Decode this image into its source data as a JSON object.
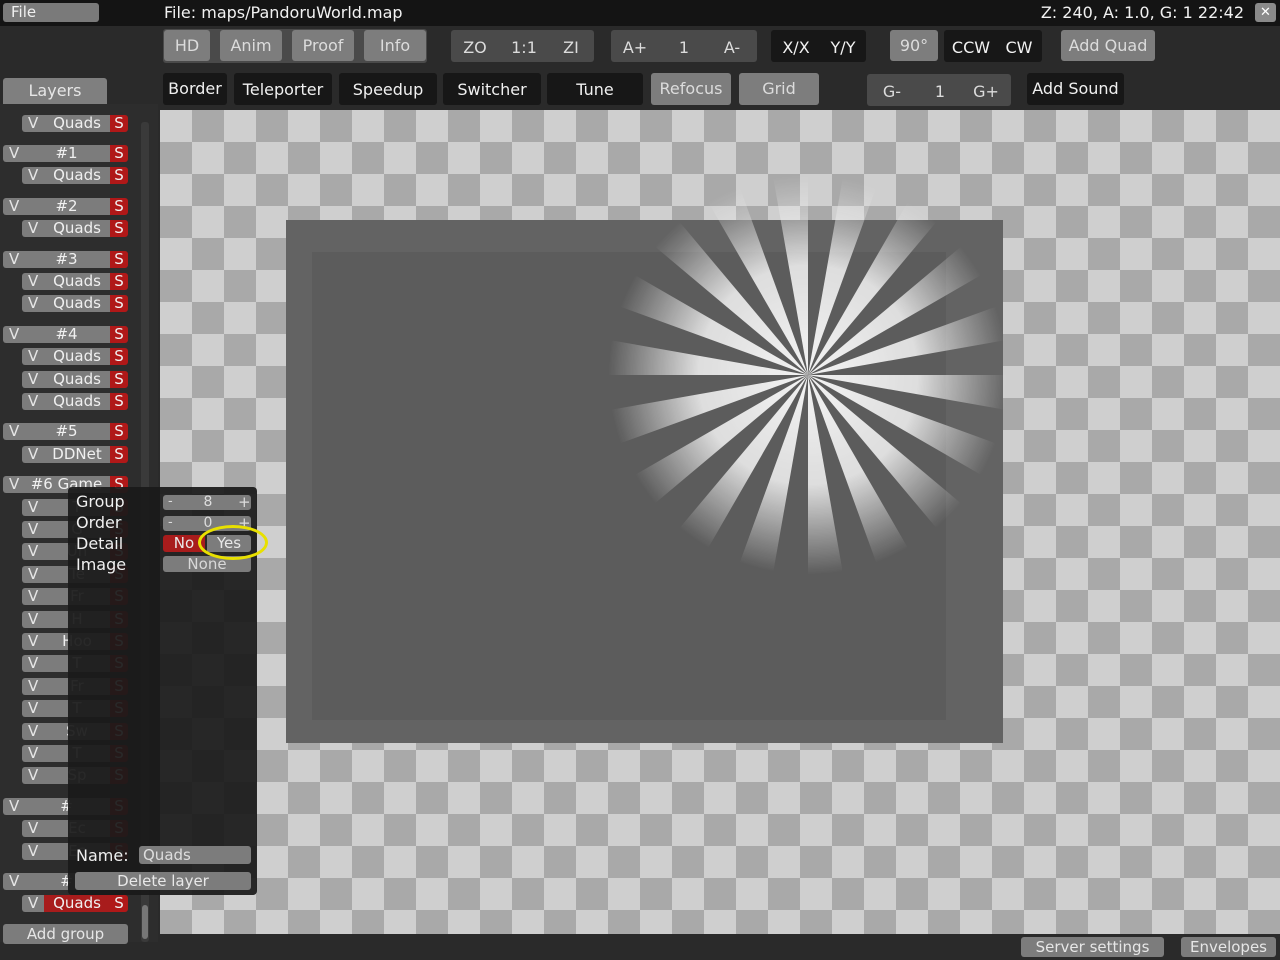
{
  "menu": {
    "file": "File"
  },
  "window": {
    "title": "File: maps/PandoruWorld.map",
    "status": "Z: 240, A: 1.0, G: 1  22:42",
    "close": "✕"
  },
  "toolbar1": {
    "view": [
      "HD",
      "Anim",
      "Proof",
      "Info"
    ],
    "zoom_out": "ZO",
    "zoom_normal": "1:1",
    "zoom_in": "ZI",
    "anim_faster": "A+",
    "anim_speed": "1",
    "anim_slower": "A-",
    "flip_x": "X/X",
    "flip_y": "Y/Y",
    "rotate_angle": "90°",
    "rotate_ccw": "CCW",
    "rotate_cw": "CW",
    "add_quad": "Add Quad"
  },
  "toolbar2": {
    "layer_tools": [
      "Border",
      "Teleporter",
      "Speedup",
      "Switcher",
      "Tune"
    ],
    "refocus": "Refocus",
    "grid": "Grid",
    "grid_minus": "G-",
    "grid_factor": "1",
    "grid_plus": "G+",
    "add_sound": "Add Sound"
  },
  "layers_tab": "Layers",
  "layers": [
    {
      "kind": "layer",
      "name": "Quads",
      "v": "V",
      "s": "S"
    },
    {
      "kind": "group",
      "name": "#1",
      "v": "V",
      "s": "S"
    },
    {
      "kind": "layer",
      "name": "Quads",
      "v": "V",
      "s": "S"
    },
    {
      "kind": "group",
      "name": "#2",
      "v": "V",
      "s": "S"
    },
    {
      "kind": "layer",
      "name": "Quads",
      "v": "V",
      "s": "S"
    },
    {
      "kind": "group",
      "name": "#3",
      "v": "V",
      "s": "S"
    },
    {
      "kind": "layer",
      "name": "Quads",
      "v": "V",
      "s": "S"
    },
    {
      "kind": "layer",
      "name": "Quads",
      "v": "V",
      "s": "S"
    },
    {
      "kind": "group",
      "name": "#4",
      "v": "V",
      "s": "S"
    },
    {
      "kind": "layer",
      "name": "Quads",
      "v": "V",
      "s": "S"
    },
    {
      "kind": "layer",
      "name": "Quads",
      "v": "V",
      "s": "S"
    },
    {
      "kind": "layer",
      "name": "Quads",
      "v": "V",
      "s": "S"
    },
    {
      "kind": "group",
      "name": "#5",
      "v": "V",
      "s": "S"
    },
    {
      "kind": "layer",
      "name": "DDNet",
      "v": "V",
      "s": "S"
    },
    {
      "kind": "group",
      "name": "#6 Game",
      "v": "V",
      "s": "S"
    },
    {
      "kind": "layer",
      "name": "T",
      "v": "V",
      "s": "S"
    },
    {
      "kind": "layer",
      "name": "G",
      "v": "V",
      "s": "S"
    },
    {
      "kind": "layer",
      "name": "Un",
      "v": "V",
      "s": "S"
    },
    {
      "kind": "layer",
      "name": "Te",
      "v": "V",
      "s": "S"
    },
    {
      "kind": "layer",
      "name": "Fr",
      "v": "V",
      "s": "S"
    },
    {
      "kind": "layer",
      "name": "H",
      "v": "V",
      "s": "S"
    },
    {
      "kind": "layer",
      "name": "Hoo",
      "v": "V",
      "s": "S"
    },
    {
      "kind": "layer",
      "name": "T",
      "v": "V",
      "s": "S"
    },
    {
      "kind": "layer",
      "name": "Fr",
      "v": "V",
      "s": "S"
    },
    {
      "kind": "layer",
      "name": "T",
      "v": "V",
      "s": "S"
    },
    {
      "kind": "layer",
      "name": "Sw",
      "v": "V",
      "s": "S"
    },
    {
      "kind": "layer",
      "name": "T",
      "v": "V",
      "s": "S"
    },
    {
      "kind": "layer",
      "name": "Sp",
      "v": "V",
      "s": "S"
    },
    {
      "kind": "group",
      "name": "#",
      "v": "V",
      "s": "S"
    },
    {
      "kind": "layer",
      "name": "Ec",
      "v": "V",
      "s": "S"
    },
    {
      "kind": "layer",
      "name": "Ec",
      "v": "V",
      "s": "S"
    },
    {
      "kind": "group",
      "name": "#",
      "v": "V",
      "s": "S",
      "selected": true
    },
    {
      "kind": "layer",
      "name": "Quads",
      "v": "V",
      "s": "S",
      "selected": true
    }
  ],
  "add_group": "Add group",
  "popup": {
    "group_label": "Group",
    "group_value": "8",
    "minus": "-",
    "plus": "+",
    "order_label": "Order",
    "order_value": "0",
    "detail_label": "Detail",
    "detail_no": "No",
    "detail_yes": "Yes",
    "image_label": "Image",
    "image_value": "None",
    "name_label": "Name:",
    "name_value": "Quads",
    "delete": "Delete layer"
  },
  "bottom": {
    "server_settings": "Server settings",
    "envelopes": "Envelopes"
  },
  "colors": {
    "selected": "#a81c1c",
    "solo": "#b01818",
    "highlight": "#e8e000"
  }
}
